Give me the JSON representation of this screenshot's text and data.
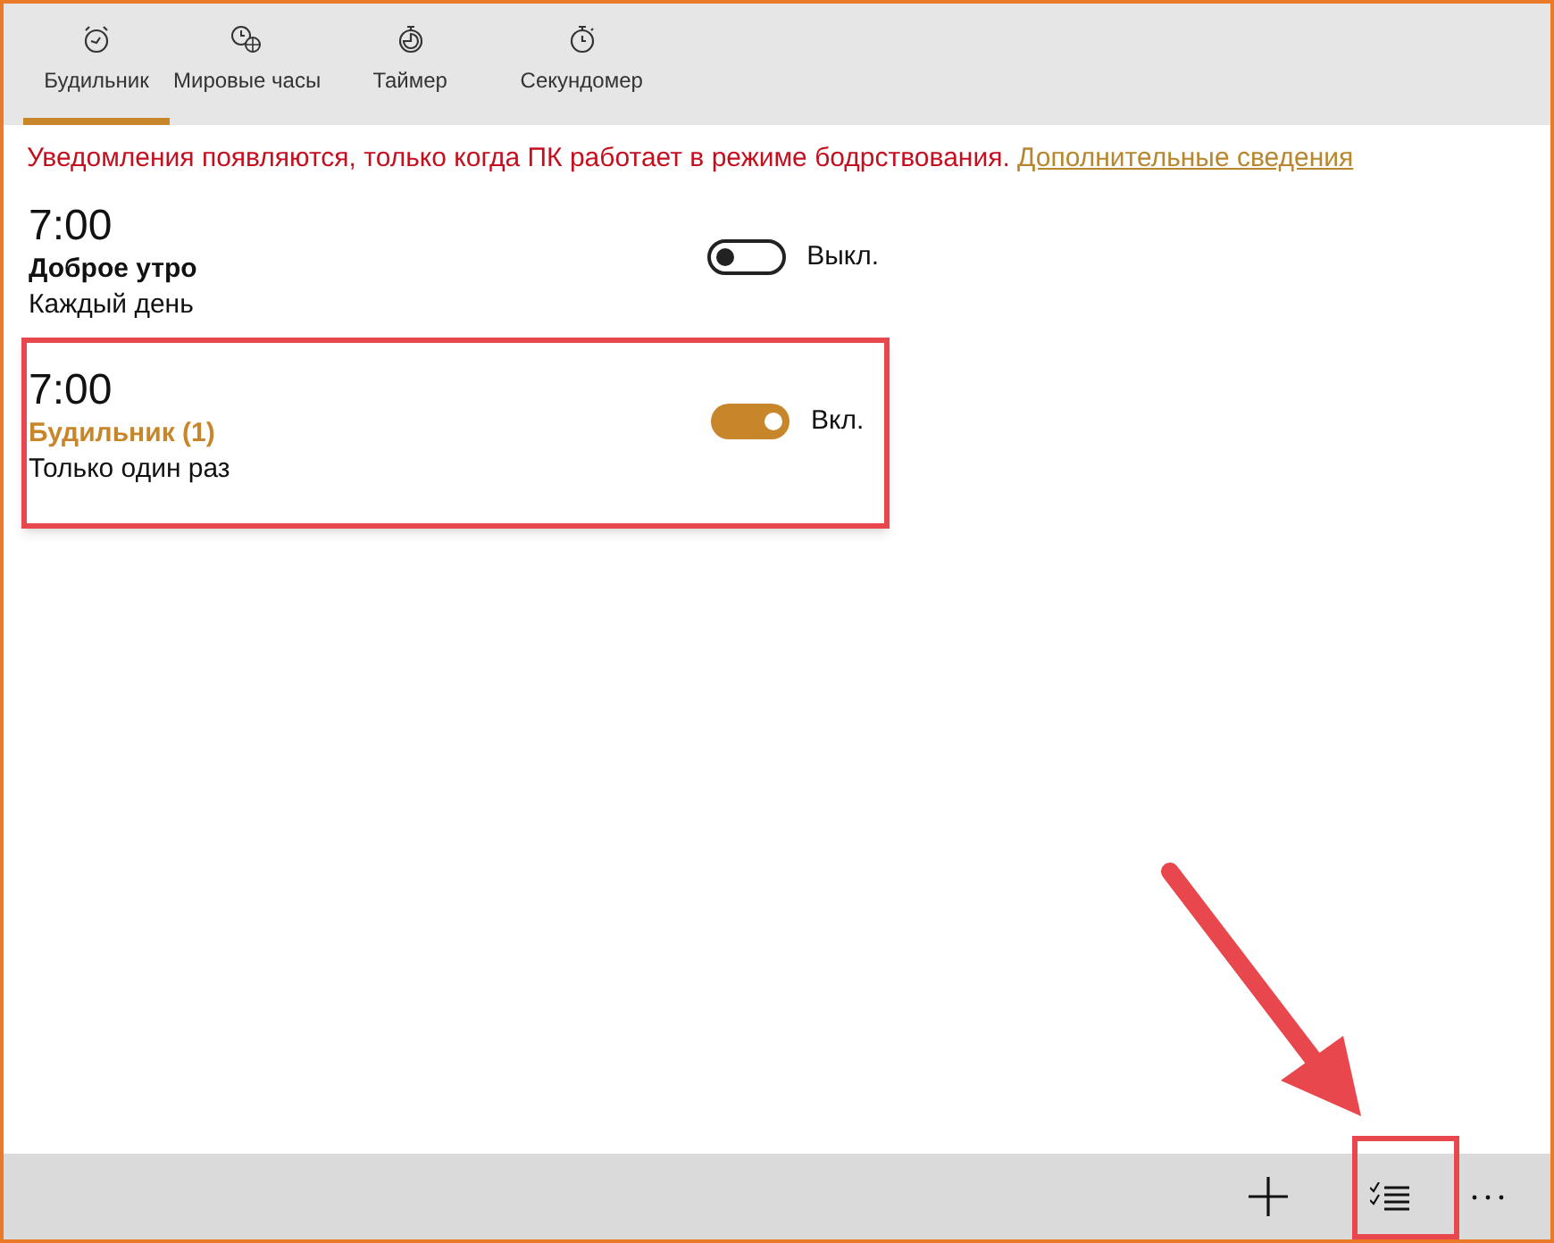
{
  "tabs": [
    {
      "label": "Будильник",
      "selected": true
    },
    {
      "label": "Мировые часы",
      "selected": false
    },
    {
      "label": "Таймер",
      "selected": false
    },
    {
      "label": "Секундомер",
      "selected": false
    }
  ],
  "notice": {
    "text": "Уведомления появляются, только когда ПК работает в режиме бодрствования.",
    "link": "Дополнительные сведения"
  },
  "alarms": [
    {
      "time": "7:00",
      "name": "Доброе утро",
      "repeat": "Каждый день",
      "on": false,
      "state_label": "Выкл."
    },
    {
      "time": "7:00",
      "name": "Будильник (1)",
      "repeat": "Только один раз",
      "on": true,
      "state_label": "Вкл."
    }
  ]
}
